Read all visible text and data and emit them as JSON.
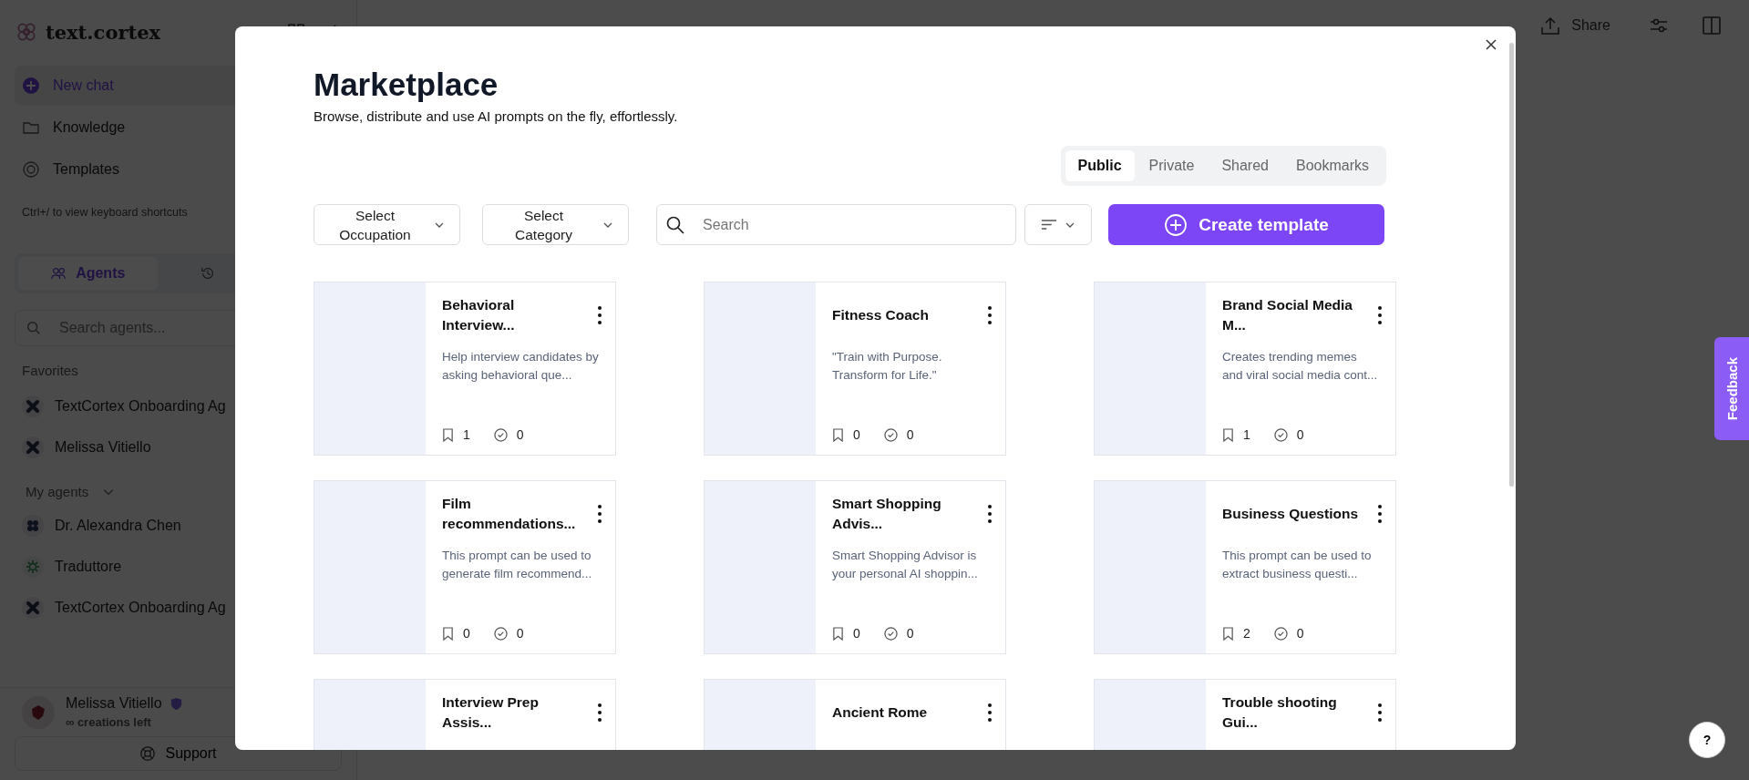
{
  "sidebar": {
    "logo": "text.cortex",
    "nav": [
      {
        "label": "New chat",
        "kind": "new",
        "selected": true
      },
      {
        "label": "Knowledge",
        "kind": "folder",
        "selected": false
      },
      {
        "label": "Templates",
        "kind": "target",
        "selected": false
      }
    ],
    "shortcut_hint": "Ctrl+/ to view keyboard shortcuts",
    "tabs": [
      {
        "label": "Agents",
        "selected": true
      }
    ],
    "search": {
      "placeholder": "Search agents..."
    },
    "favorites_heading": "Favorites",
    "favorites": [
      {
        "name": "TextCortex Onboarding Ag",
        "kind": "cross"
      },
      {
        "name": "Melissa Vitiello",
        "kind": "cross"
      }
    ],
    "my_agents_heading": "My agents",
    "my_agents": [
      {
        "name": "Dr. Alexandra Chen",
        "kind": "clover"
      },
      {
        "name": "Traduttore",
        "kind": "gear"
      },
      {
        "name": "TextCortex Onboarding Ag",
        "kind": "cross"
      }
    ],
    "user": {
      "name": "Melissa Vitiello",
      "credits": "∞ creations left"
    },
    "support": "Support"
  },
  "topbar": {
    "share": "Share"
  },
  "modal": {
    "title": "Marketplace",
    "subtitle": "Browse, distribute and use AI prompts on the fly, effortlessly.",
    "tabs": [
      {
        "label": "Public",
        "selected": true
      },
      {
        "label": "Private",
        "selected": false
      },
      {
        "label": "Shared",
        "selected": false
      },
      {
        "label": "Bookmarks",
        "selected": false
      }
    ],
    "filters": [
      {
        "label": "Select Occupation"
      },
      {
        "label": "Select Category"
      }
    ],
    "search": {
      "placeholder": "Search"
    },
    "create_button": "Create template",
    "cards": [
      {
        "title": "Behavioral Interview...",
        "description": "Help interview candidates by asking behavioral que...",
        "bookmarks": "1",
        "uses": "0"
      },
      {
        "title": "Fitness Coach",
        "description": "\"Train with Purpose. Transform for Life.\"",
        "bookmarks": "0",
        "uses": "0"
      },
      {
        "title": "Brand Social Media M...",
        "description": "Creates trending memes and viral social media cont...",
        "bookmarks": "1",
        "uses": "0"
      },
      {
        "title": "Film recommendations...",
        "description": "This prompt can be used to generate film recommend...",
        "bookmarks": "0",
        "uses": "0"
      },
      {
        "title": "Smart Shopping Advis...",
        "description": "Smart Shopping Advisor is your personal AI shoppin...",
        "bookmarks": "0",
        "uses": "0"
      },
      {
        "title": "Business Questions",
        "description": "This prompt can be used to extract business questi...",
        "bookmarks": "2",
        "uses": "0"
      },
      {
        "title": "Interview Prep Assis..."
      },
      {
        "title": "Ancient Rome"
      },
      {
        "title": "Trouble shooting Gui..."
      }
    ]
  },
  "feedback": "Feedback",
  "help": "?"
}
